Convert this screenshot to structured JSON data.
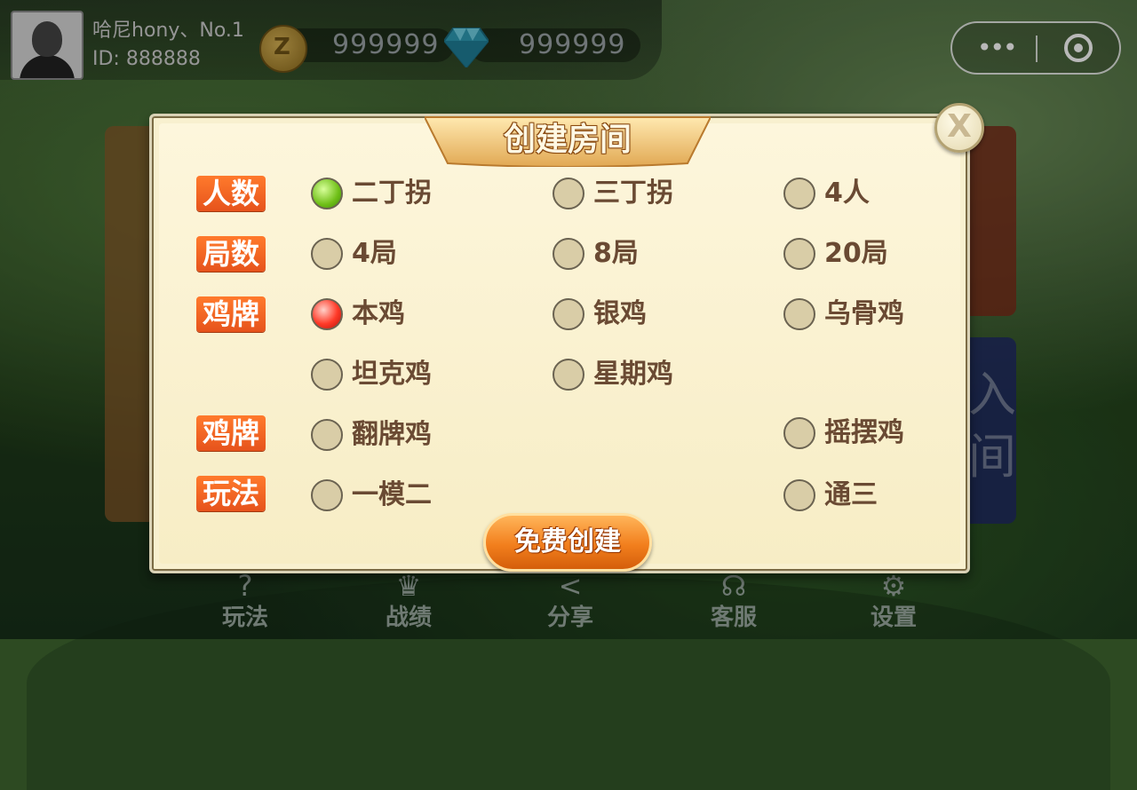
{
  "player": {
    "nickname": "哈尼hony、No.1",
    "id_text": "ID: 888888"
  },
  "currency": {
    "gold_value": "999999",
    "diamond_value": "999999",
    "gold_icon_glyph": "Z"
  },
  "capsule": {
    "more_glyph": "•••"
  },
  "background": {
    "right_card_glyph_1": "入",
    "right_card_glyph_2": "间"
  },
  "nav": [
    {
      "label": "玩法",
      "icon": "question-circle-icon",
      "glyph": "?"
    },
    {
      "label": "战绩",
      "icon": "trophy-icon",
      "glyph": "♛"
    },
    {
      "label": "分享",
      "icon": "share-icon",
      "glyph": "<"
    },
    {
      "label": "客服",
      "icon": "headset-icon",
      "glyph": "☊"
    },
    {
      "label": "设置",
      "icon": "gear-icon",
      "glyph": "⚙"
    }
  ],
  "dialog": {
    "title": "创建房间",
    "close_glyph": "X",
    "create_label": "免费创建"
  },
  "categories": {
    "players": "人数",
    "rounds": "局数",
    "chicken": "鸡牌",
    "chicken2": "鸡牌",
    "rules": "玩法"
  },
  "options": {
    "players": [
      "二丁拐",
      "三丁拐",
      "4人"
    ],
    "rounds": [
      "4局",
      "8局",
      "20局"
    ],
    "chicken_row1": [
      "本鸡",
      "银鸡",
      "乌骨鸡"
    ],
    "chicken_row2": [
      "坦克鸡",
      "星期鸡"
    ],
    "chicken2_row": [
      "翻牌鸡",
      "摇摆鸡"
    ],
    "rules_row": [
      "一模二",
      "通三"
    ]
  },
  "selected": {
    "players": "二丁拐",
    "chicken": "本鸡"
  },
  "colors": {
    "category_orange": "#e6531c",
    "selected_green": "#6fbf17",
    "selected_red": "#ff3a28",
    "option_text": "#6a4a33"
  }
}
